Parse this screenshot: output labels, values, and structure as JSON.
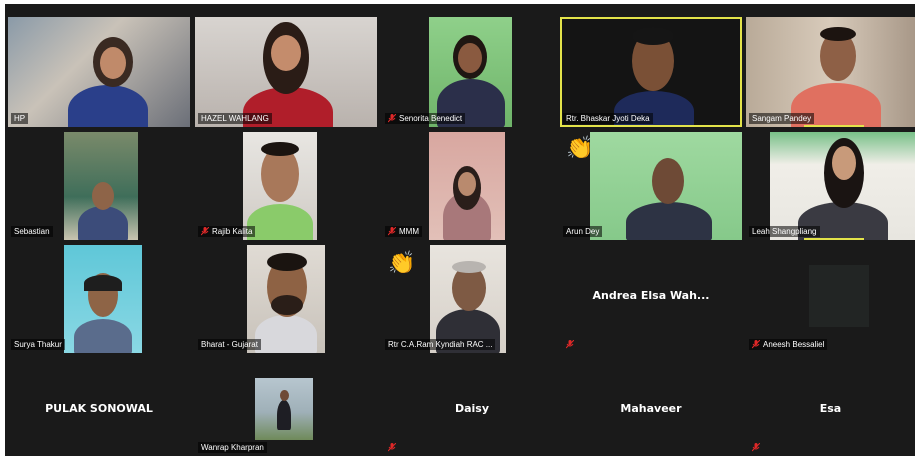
{
  "participants": [
    {
      "name": "HP"
    },
    {
      "name": "HAZEL WAHLANG"
    },
    {
      "name": "Senorita Benedict"
    },
    {
      "name": "Rtr. Bhaskar Jyoti Deka"
    },
    {
      "name": "Sangam Pandey"
    },
    {
      "name": "Sebastian"
    },
    {
      "name": "Rajib Kalita"
    },
    {
      "name": "MMM"
    },
    {
      "name": "Arun Dey"
    },
    {
      "name": "Leah Shangpliang"
    },
    {
      "name": "Surya Thakur"
    },
    {
      "name": "Bharat - Gujarat"
    },
    {
      "name": "Rtr C.A.Ram Kyndiah RAC ..."
    },
    {
      "name": "Andrea Elsa Wah..."
    },
    {
      "name": "Aneesh Bessaliel"
    },
    {
      "name": "PULAK SONOWAL"
    },
    {
      "name": "Wanrap Kharpran"
    },
    {
      "name": "Daisy"
    },
    {
      "name": "Mahaveer"
    },
    {
      "name": "Esa"
    }
  ],
  "colors": {
    "background": "#1a1a1a",
    "active_speaker": "#e3e34a",
    "mic_muted": "#e02828"
  },
  "icons": {
    "mic_muted": "mic-muted-icon",
    "raised_hand": "clapping-hand-icon"
  }
}
